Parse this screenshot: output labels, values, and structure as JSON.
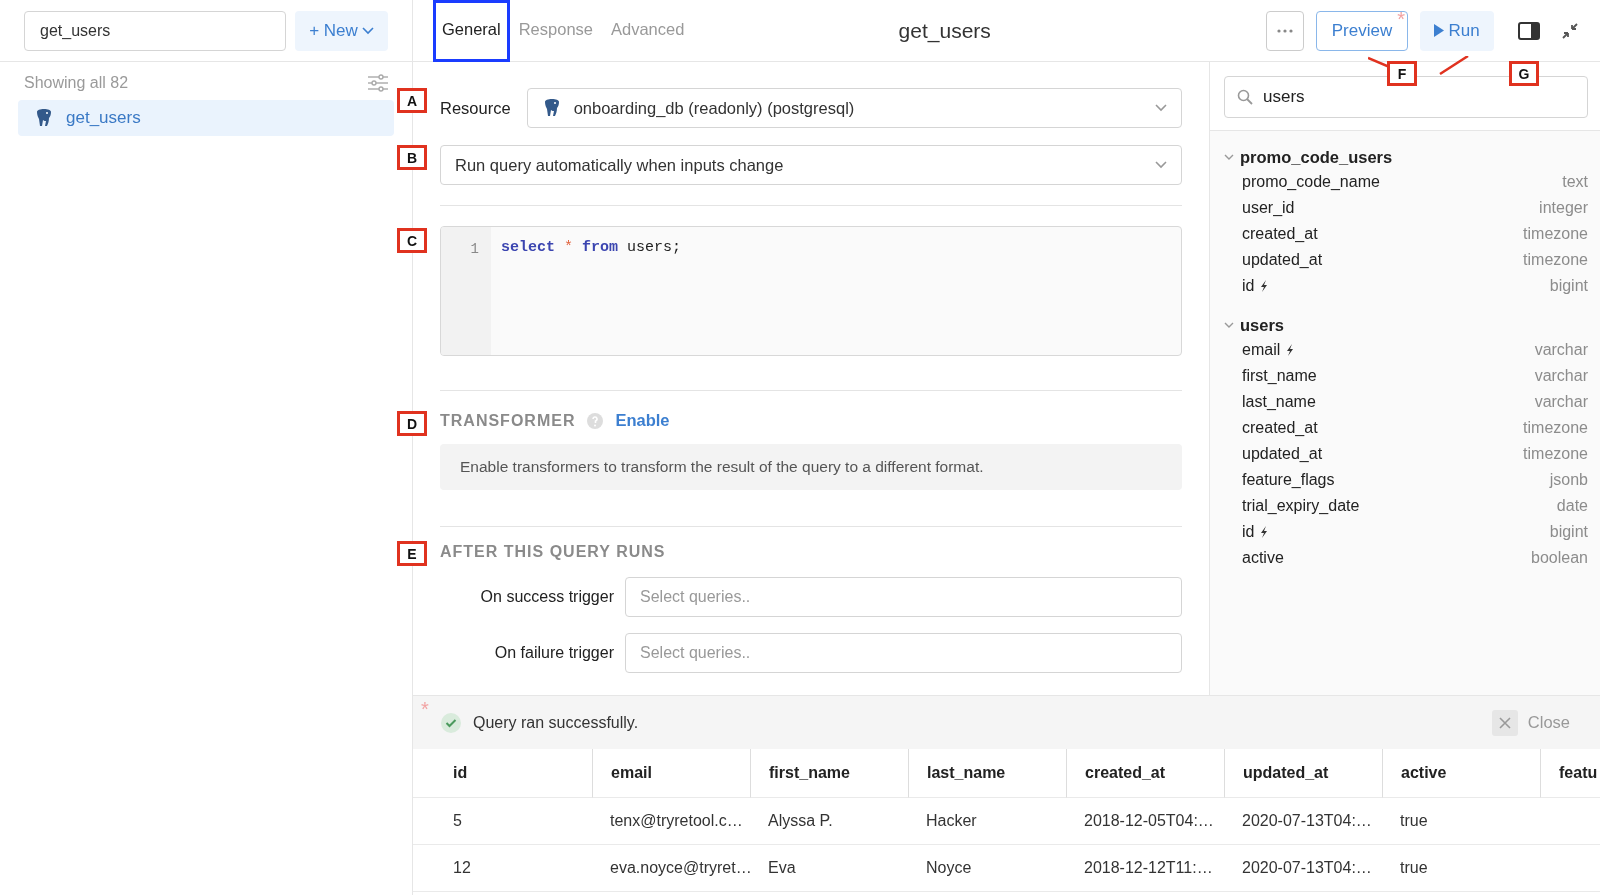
{
  "sidebar": {
    "search": {
      "value": "get_users"
    },
    "new_button": "+ New",
    "summary": "Showing all 82",
    "queries": [
      {
        "name": "get_users",
        "selected": true
      }
    ]
  },
  "editor": {
    "tabs": [
      {
        "label": "General",
        "selected": true,
        "outlined": true
      },
      {
        "label": "Response",
        "selected": false,
        "outlined": false
      },
      {
        "label": "Advanced",
        "selected": false,
        "outlined": false
      }
    ],
    "title": "get_users",
    "preview": "Preview",
    "preview_mark": "*",
    "run": "Run",
    "annotations": [
      "F",
      "G"
    ]
  },
  "resource": {
    "annotation": "A",
    "label": "Resource",
    "value": "onboarding_db (readonly) (postgresql)"
  },
  "run_mode": {
    "annotation": "B",
    "value": "Run query automatically when inputs change"
  },
  "code": {
    "annotation": "C",
    "lines": [
      {
        "number": "1",
        "tokens": [
          {
            "text": "select",
            "kind": "keyword"
          },
          {
            "text": "*",
            "kind": "operator"
          },
          {
            "text": "from",
            "kind": "keyword"
          },
          {
            "text": "users;",
            "kind": "plain"
          }
        ]
      }
    ]
  },
  "transformer": {
    "annotation": "D",
    "title": "TRANSFORMER",
    "action": "Enable",
    "description": "Enable transformers to transform the result of the query to a different format."
  },
  "after_run": {
    "annotation": "E",
    "title": "AFTER THIS QUERY RUNS",
    "triggers": [
      {
        "label": "On success trigger",
        "placeholder": "Select queries.."
      },
      {
        "label": "On failure trigger",
        "placeholder": "Select queries.."
      }
    ]
  },
  "schema": {
    "search": {
      "value": "users"
    },
    "tables": [
      {
        "name": "promo_code_users",
        "expanded": true,
        "columns": [
          {
            "name": "promo_code_name",
            "type": "text",
            "key": false
          },
          {
            "name": "user_id",
            "type": "integer",
            "key": false
          },
          {
            "name": "created_at",
            "type": "timezone",
            "key": false
          },
          {
            "name": "updated_at",
            "type": "timezone",
            "key": false
          },
          {
            "name": "id",
            "type": "bigint",
            "key": true
          }
        ]
      },
      {
        "name": "users",
        "expanded": true,
        "columns": [
          {
            "name": "email",
            "type": "varchar",
            "key": true
          },
          {
            "name": "first_name",
            "type": "varchar",
            "key": false
          },
          {
            "name": "last_name",
            "type": "varchar",
            "key": false
          },
          {
            "name": "created_at",
            "type": "timezone",
            "key": false
          },
          {
            "name": "updated_at",
            "type": "timezone",
            "key": false
          },
          {
            "name": "feature_flags",
            "type": "jsonb",
            "key": false
          },
          {
            "name": "trial_expiry_date",
            "type": "date",
            "key": false
          },
          {
            "name": "id",
            "type": "bigint",
            "key": true
          },
          {
            "name": "active",
            "type": "boolean",
            "key": false
          }
        ]
      }
    ]
  },
  "results": {
    "marker": "*",
    "status": "Query ran successfully.",
    "close": "Close",
    "columns": [
      "id",
      "email",
      "first_name",
      "last_name",
      "created_at",
      "updated_at",
      "active",
      "featu"
    ],
    "rows": [
      [
        "5",
        "tenx@tryretool.c…",
        "Alyssa P.",
        "Hacker",
        "2018-12-05T04:…",
        "2020-07-13T04:…",
        "true"
      ],
      [
        "12",
        "eva.noyce@tryret…",
        "Eva",
        "Noyce",
        "2018-12-12T11:…",
        "2020-07-13T04:…",
        "true"
      ]
    ]
  }
}
